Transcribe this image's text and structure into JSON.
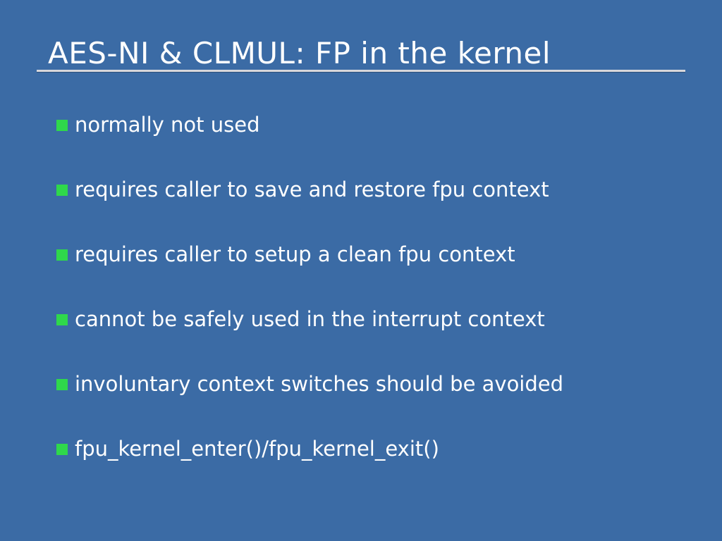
{
  "colors": {
    "background": "#3b6ba5",
    "text": "#ffffff",
    "bullet": "#2fd84b",
    "rule": "#d8d8dc"
  },
  "slide": {
    "title": "AES-NI & CLMUL: FP in the kernel",
    "bullet_icon": "green-square-bullet-icon",
    "bullets": [
      "normally not used",
      "requires caller to save and restore fpu context",
      "requires caller to setup a clean fpu context",
      "cannot be safely used in the interrupt context",
      "involuntary context switches should be avoided",
      "fpu_kernel_enter()/fpu_kernel_exit()"
    ]
  }
}
